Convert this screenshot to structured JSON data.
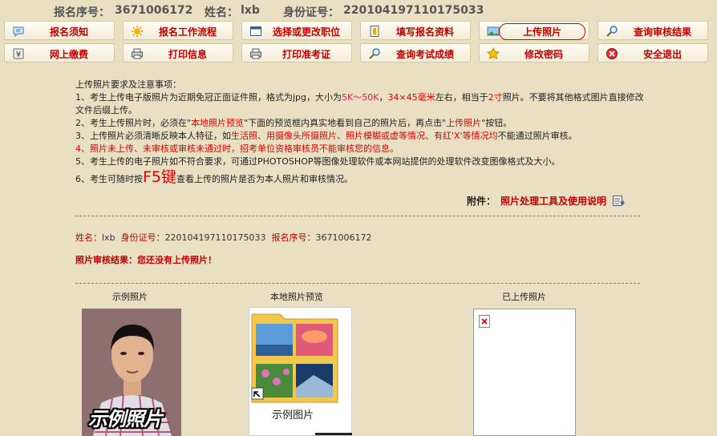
{
  "header": {
    "reg_no_label": "报名序号：",
    "reg_no": "3671006172",
    "name_label": "姓名：",
    "name": "lxb",
    "id_label": "身份证号：",
    "id_no": "220104197110175033"
  },
  "nav": {
    "row1": [
      "报名须知",
      "报名工作流程",
      "选择或更改职位",
      "填写报名资料",
      "上传照片",
      "查询审核结果"
    ],
    "row2": [
      "网上缴费",
      "打印信息",
      "打印准考证",
      "查询考试成绩",
      "修改密码",
      "安全退出"
    ]
  },
  "notice": {
    "title": "上传照片要求及注意事项：",
    "i1a": "1、考生上传电子版照片为近期免冠正面证件照，格式为jpg，大小为",
    "i1b": "5K～50K",
    "i1c": "，",
    "i1d": "34×45毫米",
    "i1e": "左右，相当于",
    "i1f": "2寸",
    "i1g": "照片。不要将其他格式图片直接修改文件后缀上传。",
    "i2a": "2、考生上传照片时，必须在\"",
    "i2b": "本地照片预览",
    "i2c": "\"下面的预览框内真实地看到自己的照片后，再点击\"",
    "i2d": "上传照片",
    "i2e": "\"按钮。",
    "i3a": "3、上传照片必须清晰反映本人特征，如",
    "i3b": "生活照、用摄像头所摄照片、照片模糊或虚等情况、有红'X'等情况均",
    "i3c": "不能通过照片审核。",
    "i4": "4、照片未上传、未审核或审核未通过时，招考单位资格审核员不能审核您的信息。",
    "i5": "5、考生上传的电子照片如不符合要求，可通过PHOTOSHOP等图像处理软件或本网站提供的处理软件改变图像格式及大小。",
    "i6a": "6、考生可随时按",
    "i6b": "F5键",
    "i6c": "查看上传的照片是否为本人照片和审核情况。"
  },
  "attachment": {
    "label": "附件：",
    "link": "照片处理工具及使用说明"
  },
  "info": {
    "name_label": "姓名：",
    "name": "lxb",
    "id_label": "身份证号：",
    "id_no": "220104197110175033",
    "reg_label": "报名序号：",
    "reg_no": "3671006172"
  },
  "result": "照片审核结果：您还没有上传照片！",
  "columns": {
    "sample": "示例照片",
    "preview": "本地照片预览",
    "uploaded": "已上传照片"
  },
  "sample_photo_caption": "示例照片",
  "preview_caption": "示例图片",
  "icons": {
    "row1": [
      "speech-bubble-icon",
      "sun-icon",
      "window-icon",
      "form-icon",
      "landscape-icon",
      "magnifier-icon"
    ],
    "row2": [
      "yen-icon",
      "printer-icon",
      "printer-icon",
      "magnifier-icon",
      "star-icon",
      "exit-icon"
    ]
  },
  "colors": {
    "accent": "#c00000",
    "background": "#e9e0c4"
  }
}
